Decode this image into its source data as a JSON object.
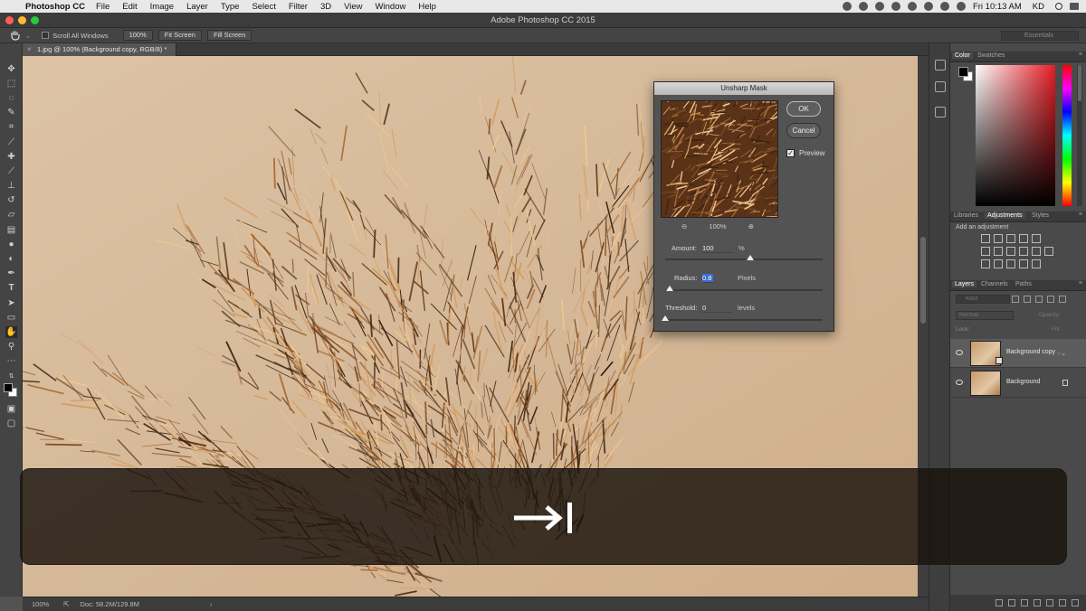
{
  "menubar": {
    "app_name": "Photoshop CC",
    "menus": [
      "File",
      "Edit",
      "Image",
      "Layer",
      "Type",
      "Select",
      "Filter",
      "3D",
      "View",
      "Window",
      "Help"
    ],
    "clock": "Fri 10:13 AM",
    "user": "KD"
  },
  "window": {
    "title": "Adobe Photoshop CC 2015"
  },
  "options_bar": {
    "scroll_all_windows": "Scroll All Windows",
    "zoom_100": "100%",
    "fit_screen": "Fit Screen",
    "fill_screen": "Fill Screen",
    "workspace": "Essentials"
  },
  "document": {
    "tab_label": "1.jpg @ 100% (Background copy, RGB/8) *"
  },
  "status_bar": {
    "zoom": "100%",
    "doc_size": "Doc: 58.2M/129.8M"
  },
  "color_panel": {
    "tabs": [
      "Color",
      "Swatches"
    ]
  },
  "adjustments_panel": {
    "tabs": [
      "Libraries",
      "Adjustments",
      "Styles"
    ],
    "hint": "Add an adjustment"
  },
  "layers_panel": {
    "tabs": [
      "Layers",
      "Channels",
      "Paths"
    ],
    "filter_kind": "Kind",
    "blend_mode": "Normal",
    "opacity_label": "Opacity:",
    "lock_label": "Lock:",
    "fill_label": "Fill:",
    "layers": [
      {
        "name": "Background copy"
      },
      {
        "name": "Background"
      }
    ]
  },
  "unsharp_mask": {
    "title": "Unsharp Mask",
    "ok_label": "OK",
    "cancel_label": "Cancel",
    "preview_label": "Preview",
    "preview_checked": true,
    "preview_zoom": "100%",
    "amount_label": "Amount:",
    "amount_value": "100",
    "amount_unit": "%",
    "amount_fraction": 0.54,
    "radius_label": "Radius:",
    "radius_value": "0.8",
    "radius_unit": "Pixels",
    "radius_fraction": 0.03,
    "threshold_label": "Threshold:",
    "threshold_value": "0",
    "threshold_unit": "levels",
    "threshold_fraction": 0.0
  },
  "key_overlay": {
    "key": "tab-key-icon"
  }
}
